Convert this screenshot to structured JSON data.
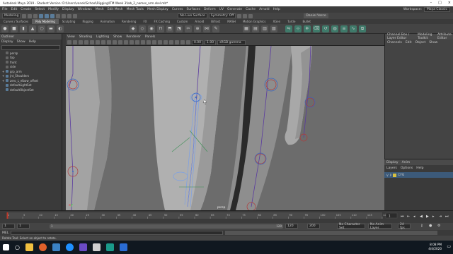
{
  "window": {
    "title": "Autodesk Maya 2019 - Student Version: D:\\Users\\vanek\\School\\Rigging\\ITM Week 3\\lab_2_names_arm.skel.mb*"
  },
  "menubar": {
    "items": [
      "File",
      "Edit",
      "Create",
      "Select",
      "Modify",
      "Display",
      "Windows",
      "Mesh",
      "Edit Mesh",
      "Mesh Tools",
      "Mesh Display",
      "Curves",
      "Surfaces",
      "Deform",
      "UV",
      "Generate",
      "Cache",
      "Arnold",
      "Help"
    ],
    "workspace_label": "Workspace:",
    "workspace_value": "Maya Classic"
  },
  "statusline": {
    "mode": "Modeling",
    "no_live": "No Live Surface",
    "symmetry": "Symmetry: Off",
    "signin": "Daniel Varco"
  },
  "shelf_tabs": [
    "Curves / Surfaces",
    "Poly Modeling",
    "Sculpting",
    "Rigging",
    "Animation",
    "Rendering",
    "FX",
    "FX Caching",
    "Custom",
    "Arnold",
    "Bifrost",
    "MASH",
    "Motion Graphics",
    "XGen",
    "Turtle",
    "Bullet"
  ],
  "shelf_active": 1,
  "outliner": {
    "title": "Outliner",
    "menu": [
      "Display",
      "Show",
      "Help"
    ],
    "items": [
      "persp",
      "top",
      "front",
      "side",
      "grp_arm",
      "jnt_Shoulders",
      "zero_L_elbow_offset",
      "defaultLightSet",
      "defaultObjectSet"
    ]
  },
  "viewport": {
    "menu": [
      "View",
      "Shading",
      "Lighting",
      "Show",
      "Renderer",
      "Panels"
    ],
    "exposure": "0.00",
    "gamma": "1.00",
    "colorspace": "sRGB gamma",
    "camera": "persp"
  },
  "channelbox": {
    "tabs": [
      "Channel Box / Layer Editor",
      "Modeling Toolkit",
      "Attribute Editor"
    ],
    "menu": [
      "Channels",
      "Edit",
      "Object",
      "Show"
    ]
  },
  "layer_editor": {
    "tabs": [
      "Display",
      "Anim"
    ],
    "menu": [
      "Layers",
      "Options",
      "Help"
    ],
    "layer_name": "CFG"
  },
  "timeslider": {
    "ticks": [
      "1",
      "5",
      "10",
      "15",
      "20",
      "25",
      "30",
      "35",
      "40",
      "45",
      "50",
      "55",
      "60",
      "65",
      "70",
      "75",
      "80",
      "85",
      "90",
      "95",
      "100",
      "105",
      "110",
      "115",
      "120"
    ],
    "current_frame": "1"
  },
  "range": {
    "start": "1",
    "inner_start": "1",
    "inner_end": "120",
    "end": "120",
    "range_end": "200",
    "char_set": "No Character Set",
    "anim_layer": "No Anim Layer",
    "fps": "24 fps"
  },
  "cmdline": {
    "label": "MEL"
  },
  "helpline": {
    "text": "Rotate Tool: Select an object to rotate."
  },
  "taskbar": {
    "time": "8:08 PM",
    "date": "4/4/2020"
  }
}
